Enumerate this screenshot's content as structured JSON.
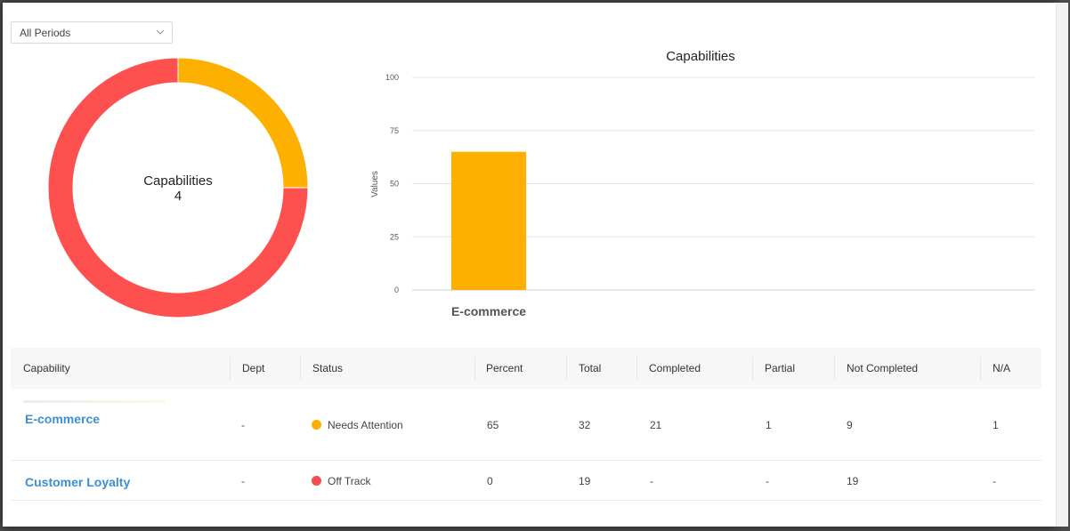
{
  "filter": {
    "selected": "All Periods"
  },
  "donut": {
    "center_label": "Capabilities",
    "center_value": "4",
    "segments": [
      {
        "value": 1,
        "color": "#FDB000"
      },
      {
        "value": 3,
        "color": "#FF5050"
      }
    ]
  },
  "chart_data": {
    "type": "bar",
    "title": "Capabilities",
    "ylabel": "Values",
    "xlabel": "",
    "ylim": [
      0,
      100
    ],
    "yticks": [
      0,
      25,
      50,
      75,
      100
    ],
    "categories": [
      "E-commerce"
    ],
    "values": [
      65
    ],
    "bar_color": "#FDB000",
    "grid": true
  },
  "table": {
    "headers": [
      "Capability",
      "Dept",
      "Status",
      "Percent",
      "Total",
      "Completed",
      "Partial",
      "Not Completed",
      "N/A"
    ],
    "rows": [
      {
        "capability": "E-commerce",
        "dept": "-",
        "status": "Needs Attention",
        "status_color": "#FDB000",
        "percent": "65",
        "total": "32",
        "completed": "21",
        "partial": "1",
        "not_completed": "9",
        "na": "1"
      },
      {
        "capability": "Customer Loyalty",
        "dept": "-",
        "status": "Off Track",
        "status_color": "#F05050",
        "percent": "0",
        "total": "19",
        "completed": "-",
        "partial": "-",
        "not_completed": "19",
        "na": "-"
      }
    ]
  }
}
